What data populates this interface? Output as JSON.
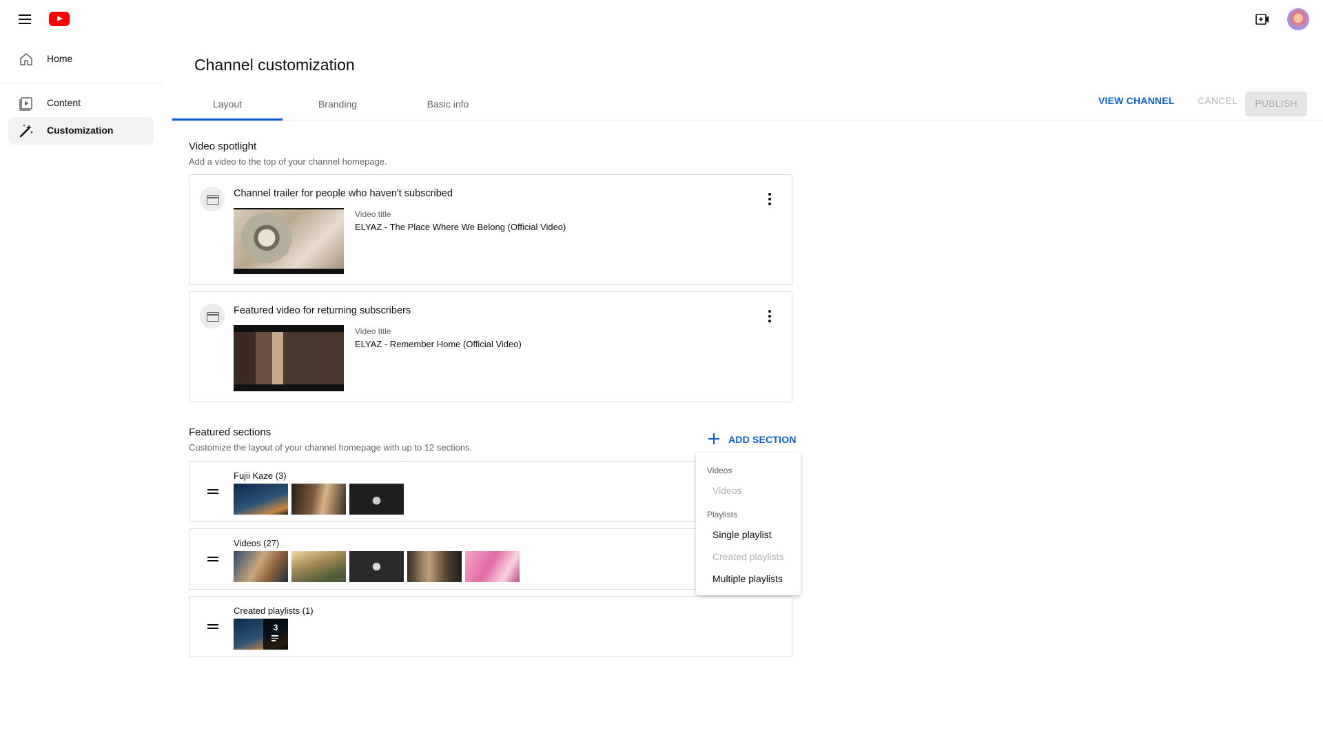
{
  "sidebar": {
    "items": [
      {
        "label": "Home",
        "icon": "home-icon"
      },
      {
        "label": "Content",
        "icon": "video-content-icon"
      },
      {
        "label": "Customization",
        "icon": "magic-wand-icon",
        "active": true
      }
    ]
  },
  "header": {
    "title": "Channel customization",
    "tabs": [
      {
        "label": "Layout",
        "active": true
      },
      {
        "label": "Branding"
      },
      {
        "label": "Basic info"
      }
    ],
    "actions": {
      "view_channel": "VIEW CHANNEL",
      "cancel": "CANCEL",
      "publish": "PUBLISH"
    }
  },
  "video_spotlight": {
    "title": "Video spotlight",
    "subtitle": "Add a video to the top of your channel homepage.",
    "cards": [
      {
        "title": "Channel trailer for people who haven't subscribed",
        "meta_label": "Video title",
        "meta_value": "ELYAZ - The Place Where We Belong (Official Video)"
      },
      {
        "title": "Featured video for returning subscribers",
        "meta_label": "Video title",
        "meta_value": "ELYAZ - Remember Home (Official Video)"
      }
    ]
  },
  "featured_sections": {
    "title": "Featured sections",
    "subtitle": "Customize the layout of your channel homepage with up to 12 sections.",
    "add_label": "ADD SECTION",
    "sections": [
      {
        "title": "Fujii Kaze (3)",
        "thumb_count": 3
      },
      {
        "title": "Videos (27)",
        "thumb_count": 5
      },
      {
        "title": "Created playlists (1)",
        "thumb_count": 1,
        "playlist_count": "3"
      }
    ]
  },
  "add_menu": {
    "group_videos": "Videos",
    "item_videos": "Videos",
    "group_playlists": "Playlists",
    "item_single_playlist": "Single playlist",
    "item_created_playlists": "Created playlists",
    "item_multiple_playlists": "Multiple playlists"
  },
  "colors": {
    "accent": "#065fd4",
    "brand_red": "#ff0000",
    "disabled_text": "#b0b0b0"
  }
}
